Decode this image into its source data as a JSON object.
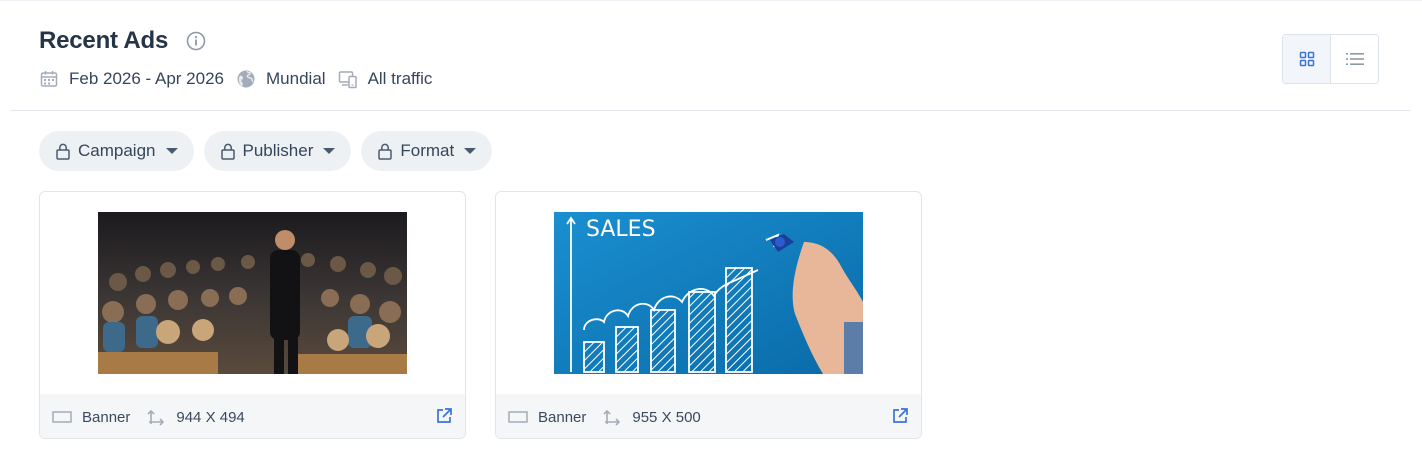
{
  "header": {
    "title": "Recent Ads",
    "date_range": "Feb 2026 - Apr 2026",
    "region": "Mundial",
    "traffic": "All traffic"
  },
  "view_toggle": {
    "selected": "grid"
  },
  "filters": [
    {
      "label": "Campaign",
      "icon": "lock-icon"
    },
    {
      "label": "Publisher",
      "icon": "lock-icon"
    },
    {
      "label": "Format",
      "icon": "lock-icon"
    }
  ],
  "ads": [
    {
      "format": "Banner",
      "size": "944 X 494",
      "image": "audience-speaker-photo"
    },
    {
      "format": "Banner",
      "size": "955 X 500",
      "image": "sales-growth-chart-photo",
      "image_text": "SALES"
    }
  ],
  "colors": {
    "accent": "#3b73d9",
    "text": "#2b3a4e",
    "muted_icon": "#a3acb8"
  }
}
